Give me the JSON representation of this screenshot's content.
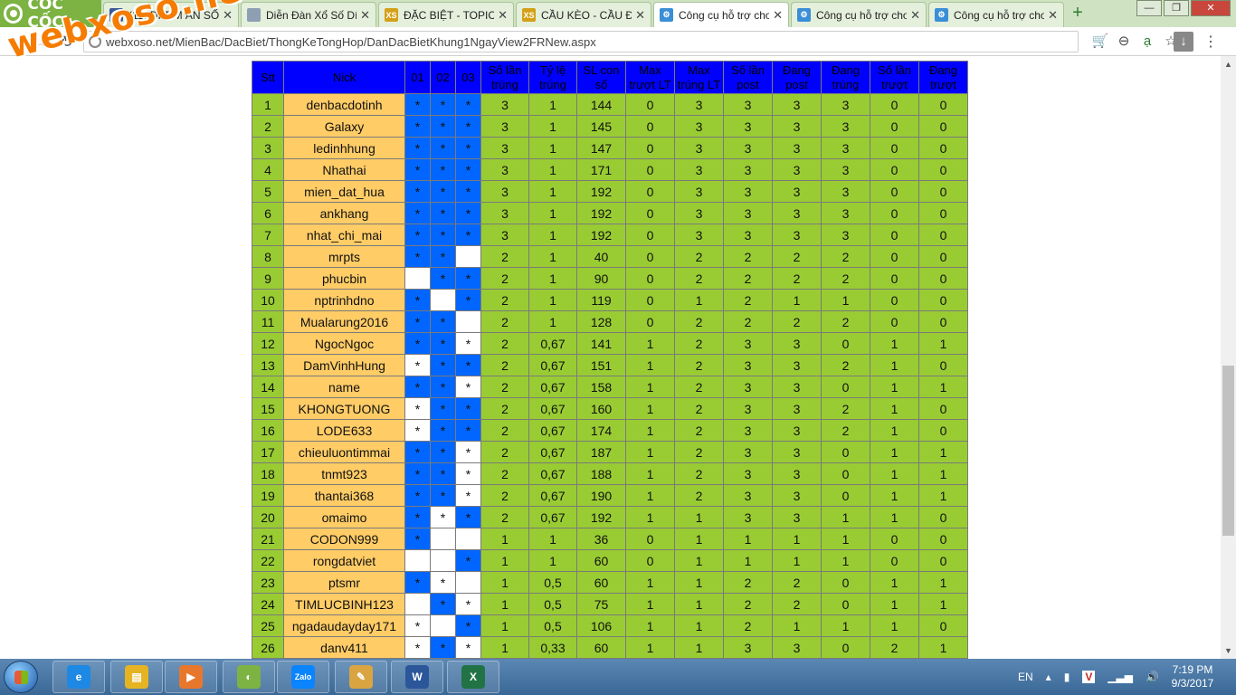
{
  "browser": {
    "brand": "CỐC CỐC",
    "tabs": [
      {
        "title": "(11) ĐI TÌM ẨN SỐ",
        "icon": "facebook-icon",
        "color": "#3b5998",
        "glyph": "f"
      },
      {
        "title": "Diễn Đàn Xổ Số Dí",
        "icon": "page-icon",
        "color": "#8e9fb3",
        "glyph": ""
      },
      {
        "title": "ĐẶC BIỆT - TOPIC",
        "icon": "xs-icon",
        "color": "#d4a017",
        "glyph": "XS"
      },
      {
        "title": "CẦU KÈO - CẦU Đ",
        "icon": "xs-icon",
        "color": "#d4a017",
        "glyph": "XS"
      },
      {
        "title": "Công cụ hỗ trợ chơ",
        "icon": "tool-icon",
        "color": "#3a8fd6",
        "glyph": "⚙"
      },
      {
        "title": "Công cụ hỗ trợ chơ",
        "icon": "tool-icon",
        "color": "#3a8fd6",
        "glyph": "⚙"
      },
      {
        "title": "Công cụ hỗ trợ chơ",
        "icon": "tool-icon",
        "color": "#3a8fd6",
        "glyph": "⚙"
      }
    ],
    "url": "webxoso.net/MienBac/DacBiet/ThongKeTongHop/DanDacBietKhung1NgayView2FRNew.aspx"
  },
  "watermark": "webxoso.net",
  "table": {
    "headers": [
      "Stt",
      "Nick",
      "01",
      "02",
      "03",
      "Số lần trúng",
      "Tỷ lệ trúng",
      "SL con số",
      "Max trượt LT",
      "Max trúng LT",
      "Số lần post",
      "Đang post",
      "Đang trúng",
      "Số lần trượt",
      "Đang trượt"
    ],
    "marks_legend": {
      "b": "blue cell",
      "w": "white cell",
      "B": "blue cell with *",
      "W": "white cell with *"
    },
    "rows": [
      [
        "1",
        "denbacdotinh",
        "BBB",
        "3",
        "1",
        "144",
        "0",
        "3",
        "3",
        "3",
        "3",
        "0",
        "0"
      ],
      [
        "2",
        "Galaxy",
        "BBB",
        "3",
        "1",
        "145",
        "0",
        "3",
        "3",
        "3",
        "3",
        "0",
        "0"
      ],
      [
        "3",
        "ledinhhung",
        "BBB",
        "3",
        "1",
        "147",
        "0",
        "3",
        "3",
        "3",
        "3",
        "0",
        "0"
      ],
      [
        "4",
        "Nhathai",
        "BBB",
        "3",
        "1",
        "171",
        "0",
        "3",
        "3",
        "3",
        "3",
        "0",
        "0"
      ],
      [
        "5",
        "mien_dat_hua",
        "BBB",
        "3",
        "1",
        "192",
        "0",
        "3",
        "3",
        "3",
        "3",
        "0",
        "0"
      ],
      [
        "6",
        "ankhang",
        "BBB",
        "3",
        "1",
        "192",
        "0",
        "3",
        "3",
        "3",
        "3",
        "0",
        "0"
      ],
      [
        "7",
        "nhat_chi_mai",
        "BBB",
        "3",
        "1",
        "192",
        "0",
        "3",
        "3",
        "3",
        "3",
        "0",
        "0"
      ],
      [
        "8",
        "mrpts",
        "BBw",
        "2",
        "1",
        "40",
        "0",
        "2",
        "2",
        "2",
        "2",
        "0",
        "0"
      ],
      [
        "9",
        "phucbin",
        "wBB",
        "2",
        "1",
        "90",
        "0",
        "2",
        "2",
        "2",
        "2",
        "0",
        "0"
      ],
      [
        "10",
        "nptrinhdno",
        "BwB",
        "2",
        "1",
        "119",
        "0",
        "1",
        "2",
        "1",
        "1",
        "0",
        "0"
      ],
      [
        "11",
        "Mualarung2016",
        "BBw",
        "2",
        "1",
        "128",
        "0",
        "2",
        "2",
        "2",
        "2",
        "0",
        "0"
      ],
      [
        "12",
        "NgocNgoc",
        "BBW",
        "2",
        "0,67",
        "141",
        "1",
        "2",
        "3",
        "3",
        "0",
        "1",
        "1"
      ],
      [
        "13",
        "DamVinhHung",
        "WBB",
        "2",
        "0,67",
        "151",
        "1",
        "2",
        "3",
        "3",
        "2",
        "1",
        "0"
      ],
      [
        "14",
        "name",
        "BBW",
        "2",
        "0,67",
        "158",
        "1",
        "2",
        "3",
        "3",
        "0",
        "1",
        "1"
      ],
      [
        "15",
        "KHONGTUONG",
        "WBB",
        "2",
        "0,67",
        "160",
        "1",
        "2",
        "3",
        "3",
        "2",
        "1",
        "0"
      ],
      [
        "16",
        "LODE633",
        "WBB",
        "2",
        "0,67",
        "174",
        "1",
        "2",
        "3",
        "3",
        "2",
        "1",
        "0"
      ],
      [
        "17",
        "chieuluontimmai",
        "BBW",
        "2",
        "0,67",
        "187",
        "1",
        "2",
        "3",
        "3",
        "0",
        "1",
        "1"
      ],
      [
        "18",
        "tnmt923",
        "BBW",
        "2",
        "0,67",
        "188",
        "1",
        "2",
        "3",
        "3",
        "0",
        "1",
        "1"
      ],
      [
        "19",
        "thantai368",
        "BBW",
        "2",
        "0,67",
        "190",
        "1",
        "2",
        "3",
        "3",
        "0",
        "1",
        "1"
      ],
      [
        "20",
        "omaimo",
        "BWB",
        "2",
        "0,67",
        "192",
        "1",
        "1",
        "3",
        "3",
        "1",
        "1",
        "0"
      ],
      [
        "21",
        "CODON999",
        "Bww",
        "1",
        "1",
        "36",
        "0",
        "1",
        "1",
        "1",
        "1",
        "0",
        "0"
      ],
      [
        "22",
        "rongdatviet",
        "wwB",
        "1",
        "1",
        "60",
        "0",
        "1",
        "1",
        "1",
        "1",
        "0",
        "0"
      ],
      [
        "23",
        "ptsmr",
        "BWw",
        "1",
        "0,5",
        "60",
        "1",
        "1",
        "2",
        "2",
        "0",
        "1",
        "1"
      ],
      [
        "24",
        "TIMLUCBINH123",
        "wBW",
        "1",
        "0,5",
        "75",
        "1",
        "1",
        "2",
        "2",
        "0",
        "1",
        "1"
      ],
      [
        "25",
        "ngadaudayday171",
        "WwB",
        "1",
        "0,5",
        "106",
        "1",
        "1",
        "2",
        "1",
        "1",
        "1",
        "0"
      ],
      [
        "26",
        "danv411",
        "WBW",
        "1",
        "0,33",
        "60",
        "1",
        "1",
        "3",
        "3",
        "0",
        "2",
        "1"
      ]
    ]
  },
  "taskbar": {
    "apps": [
      {
        "name": "ie",
        "color": "#1e88e5",
        "glyph": "e"
      },
      {
        "name": "explorer",
        "color": "#e6b422",
        "glyph": "▤"
      },
      {
        "name": "media",
        "color": "#e8772e",
        "glyph": "▶"
      },
      {
        "name": "coccoc",
        "color": "#7cb342",
        "glyph": "◐"
      },
      {
        "name": "zalo",
        "color": "#0a84ff",
        "glyph": "Zalo"
      },
      {
        "name": "paint",
        "color": "#d9a441",
        "glyph": "✎"
      },
      {
        "name": "word",
        "color": "#2b579a",
        "glyph": "W"
      },
      {
        "name": "excel",
        "color": "#217346",
        "glyph": "X"
      }
    ],
    "language": "EN",
    "time": "7:19 PM",
    "date": "9/3/2017"
  }
}
